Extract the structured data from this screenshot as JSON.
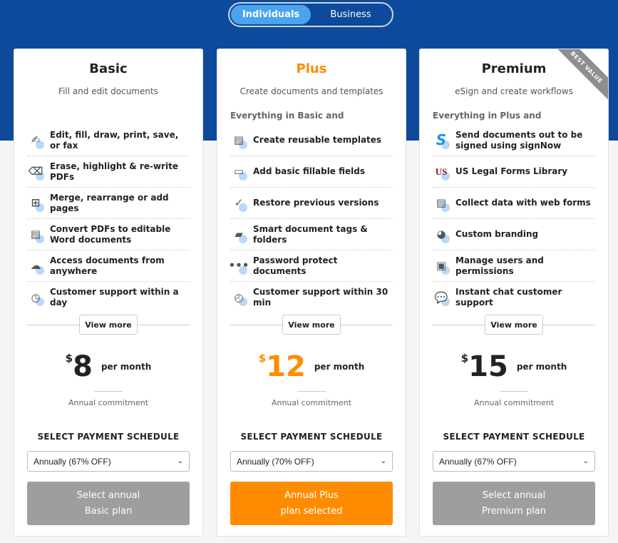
{
  "toggle": {
    "options": [
      "Individuals",
      "Business"
    ],
    "active": "Individuals"
  },
  "plans": [
    {
      "name": "Basic",
      "subtitle": "Fill and edit documents",
      "includes": "",
      "features": [
        {
          "icon": "signature-icon",
          "text": "Edit, fill, draw, print, save, or fax"
        },
        {
          "icon": "eraser-icon",
          "text": "Erase, highlight & re-write PDFs"
        },
        {
          "icon": "add-page-icon",
          "text": "Merge, rearrange or add pages"
        },
        {
          "icon": "convert-document-icon",
          "text": "Convert PDFs to editable Word documents"
        },
        {
          "icon": "cloud-icon",
          "text": "Access documents from anywhere"
        },
        {
          "icon": "clock-icon",
          "text": "Customer support within a day"
        }
      ],
      "view_more": "View more",
      "currency": "$",
      "price": "8",
      "period": "per month",
      "commitment": "Annual commitment",
      "schedule_label": "SELECT PAYMENT SCHEDULE",
      "schedule": "Annually (67% OFF)",
      "cta": "Select annual\nBasic plan"
    },
    {
      "name": "Plus",
      "subtitle": "Create documents and templates",
      "includes": "Everything in Basic and",
      "features": [
        {
          "icon": "template-icon",
          "text": "Create reusable templates"
        },
        {
          "icon": "fillable-fields-icon",
          "text": "Add basic fillable fields"
        },
        {
          "icon": "version-history-icon",
          "text": "Restore previous versions"
        },
        {
          "icon": "folder-icon",
          "text": "Smart document tags & folders"
        },
        {
          "icon": "password-icon",
          "text": "Password protect documents"
        },
        {
          "icon": "stopwatch-icon",
          "text": "Customer support within 30 min"
        }
      ],
      "view_more": "View more",
      "currency": "$",
      "price": "12",
      "period": "per month",
      "commitment": "Annual commitment",
      "schedule_label": "SELECT PAYMENT SCHEDULE",
      "schedule": "Annually (70% OFF)",
      "cta": "Annual Plus\nplan selected"
    },
    {
      "name": "Premium",
      "subtitle": "eSign and create workflows",
      "includes": "Everything in Plus and",
      "badge": "BEST VALUE",
      "features": [
        {
          "icon": "signnow-icon",
          "text": "Send documents out to be signed using signNow"
        },
        {
          "icon": "us-legal-forms-icon",
          "text": "US Legal Forms Library"
        },
        {
          "icon": "web-form-icon",
          "text": "Collect data with web forms"
        },
        {
          "icon": "branding-icon",
          "text": "Custom branding"
        },
        {
          "icon": "user-card-icon",
          "text": "Manage users and permissions"
        },
        {
          "icon": "chat-icon",
          "text": "Instant chat customer support"
        }
      ],
      "view_more": "View more",
      "currency": "$",
      "price": "15",
      "period": "per month",
      "commitment": "Annual commitment",
      "schedule_label": "SELECT PAYMENT SCHEDULE",
      "schedule": "Annually (67% OFF)",
      "cta": "Select annual\nPremium plan"
    }
  ],
  "colors": {
    "hero": "#0e4a9b",
    "accent": "#ff8c00",
    "toggle_active": "#4aa3f0",
    "inactive_button": "#9e9e9e"
  }
}
